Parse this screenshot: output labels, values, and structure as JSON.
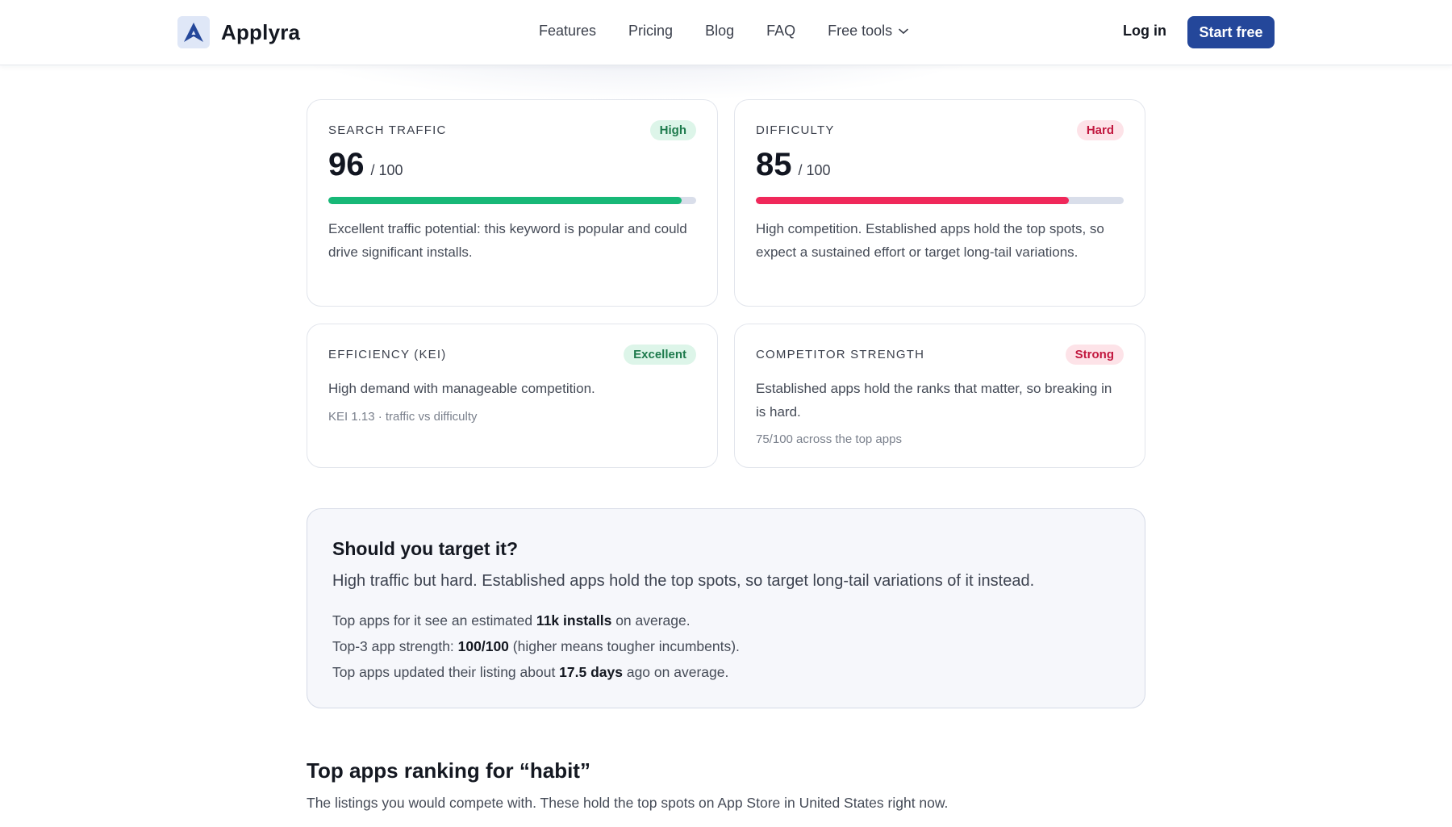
{
  "header": {
    "brand_name": "Applyra",
    "nav": [
      {
        "label": "Features"
      },
      {
        "label": "Pricing"
      },
      {
        "label": "Blog"
      },
      {
        "label": "FAQ"
      },
      {
        "label": "Free tools"
      }
    ],
    "login_label": "Log in",
    "cta_label": "Start free",
    "cta_color": "#24479a"
  },
  "metrics": {
    "traffic": {
      "label": "SEARCH TRAFFIC",
      "badge": "High",
      "score": "96",
      "max": "/ 100",
      "progress": 0.96,
      "bar_color": "#17b877",
      "description": "Excellent traffic potential: this keyword is popular and could drive significant installs."
    },
    "difficulty": {
      "label": "DIFFICULTY",
      "badge": "Hard",
      "score": "85",
      "max": "/ 100",
      "progress": 0.85,
      "bar_color": "#f0285a",
      "description": "High competition. Established apps hold the top spots, so expect a sustained effort or target long-tail variations."
    },
    "efficiency": {
      "label": "EFFICIENCY (KEI)",
      "badge": "Excellent",
      "description": "High demand with manageable competition.",
      "meta": "KEI 1.13 · traffic vs difficulty"
    },
    "competitor": {
      "label": "COMPETITOR STRENGTH",
      "badge": "Strong",
      "description": "Established apps hold the ranks that matter, so breaking in is hard.",
      "meta": "75/100 across the top apps"
    }
  },
  "target": {
    "title": "Should you target it?",
    "summary": "High traffic but hard. Established apps hold the top spots, so target long-tail variations of it instead.",
    "line1": {
      "pre": "Top apps for it see an estimated ",
      "value": "11k installs",
      "post": " on average."
    },
    "line2": {
      "pre": "Top-3 app strength: ",
      "value": "100/100",
      "post": " (higher means tougher incumbents)."
    },
    "line3": {
      "pre": "Top apps updated their listing about ",
      "value": "17.5 days",
      "post": " ago on average."
    }
  },
  "ranking": {
    "title": "Top apps ranking for “habit”",
    "subtitle": "The listings you would compete with. These hold the top spots on App Store in United States right now."
  }
}
